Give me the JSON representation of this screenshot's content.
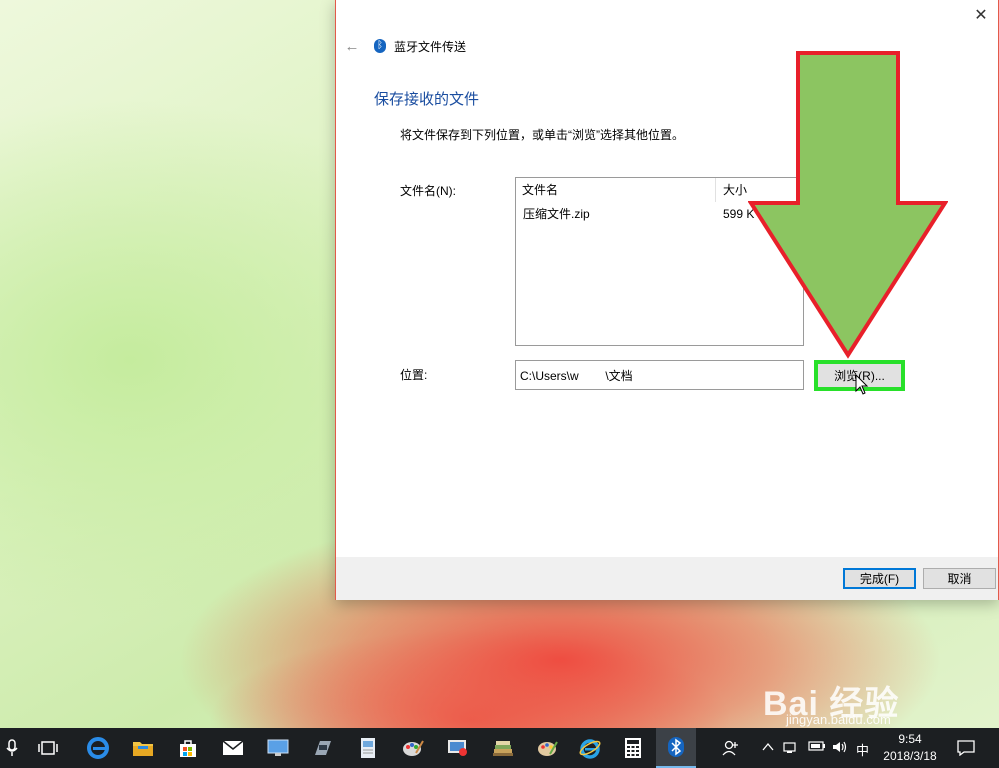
{
  "dialog": {
    "title": "蓝牙文件传送",
    "heading": "保存接收的文件",
    "instruction": "将文件保存到下列位置，或单击“浏览”选择其他位置。",
    "filename_label": "文件名(N):",
    "file_list": {
      "columns": [
        "文件名",
        "大小"
      ],
      "rows": [
        {
          "name": "压缩文件.zip",
          "size": "599 K"
        }
      ]
    },
    "location_label": "位置:",
    "location_value": "C:\\Users\\w        \\文档",
    "browse_label": "浏览(R)...",
    "finish_label": "完成(F)",
    "cancel_label": "取消"
  },
  "icons": {
    "back": "back-arrow-icon",
    "bluetooth": "bluetooth-icon",
    "close": "close-icon"
  },
  "highlight": {
    "arrow_color": "#8cc561",
    "arrow_border": "#e8202a",
    "box_color": "#28e02a"
  },
  "watermark": {
    "logo": "Bai 经验",
    "url": "jingyan.baidu.com"
  },
  "taskbar": {
    "ime": "中",
    "time": "9:54",
    "date": "2018/3/18"
  }
}
